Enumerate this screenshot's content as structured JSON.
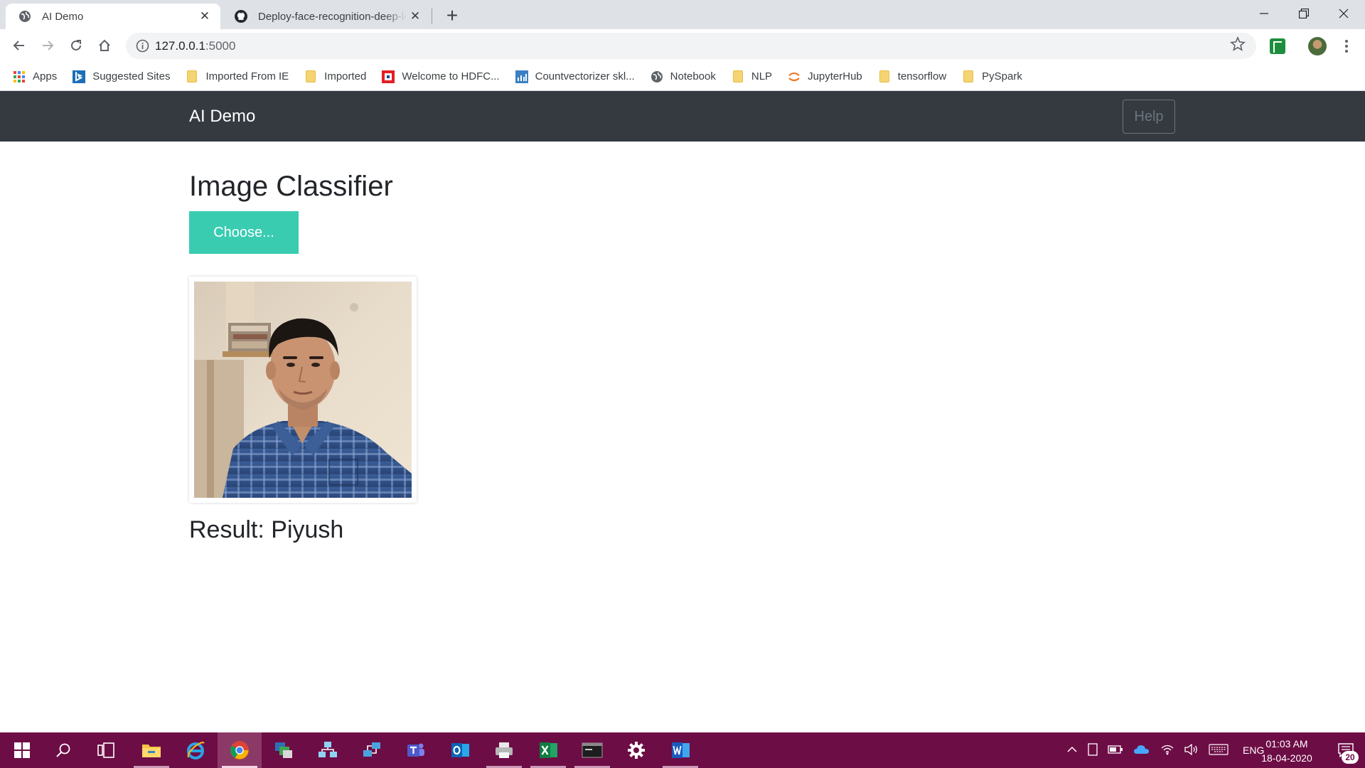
{
  "browser": {
    "tabs": [
      {
        "title": "AI Demo",
        "active": true,
        "icon": "globe-icon"
      },
      {
        "title": "Deploy-face-recognition-deep-le",
        "active": false,
        "icon": "github-icon"
      }
    ],
    "address": {
      "host": "127.0.0.1",
      "port": ":5000"
    },
    "bookmarks": [
      {
        "label": "Apps",
        "icon": "apps-grid-icon"
      },
      {
        "label": "Suggested Sites",
        "icon": "bing-icon"
      },
      {
        "label": "Imported From IE",
        "icon": "folder-icon"
      },
      {
        "label": "Imported",
        "icon": "folder-icon"
      },
      {
        "label": "Welcome to HDFC...",
        "icon": "hdfc-icon"
      },
      {
        "label": "Countvectorizer skl...",
        "icon": "sklearn-icon"
      },
      {
        "label": "Notebook",
        "icon": "globe-icon"
      },
      {
        "label": "NLP",
        "icon": "folder-icon"
      },
      {
        "label": "JupyterHub",
        "icon": "jupyter-icon"
      },
      {
        "label": "tensorflow",
        "icon": "folder-icon"
      },
      {
        "label": "PySpark",
        "icon": "folder-icon"
      }
    ]
  },
  "app": {
    "brand": "AI Demo",
    "help_label": "Help",
    "page_title": "Image Classifier",
    "choose_label": "Choose...",
    "image_desc": "uploaded photo of a man in a blue checked shirt",
    "result_text": "Result: Piyush"
  },
  "taskbar": {
    "apps": [
      "windows-start",
      "search",
      "task-view",
      "file-explorer",
      "internet-explorer",
      "chrome",
      "app-stack",
      "network-app",
      "remote-desktop",
      "teams",
      "outlook",
      "printer-app",
      "excel",
      "terminal",
      "settings",
      "word"
    ],
    "language": "ENG",
    "time": "01:03 AM",
    "date": "18-04-2020",
    "notifications": "20"
  },
  "colors": {
    "navbar": "#343a40",
    "choose_button": "#39ccb1",
    "taskbar": "#6d0d45"
  }
}
